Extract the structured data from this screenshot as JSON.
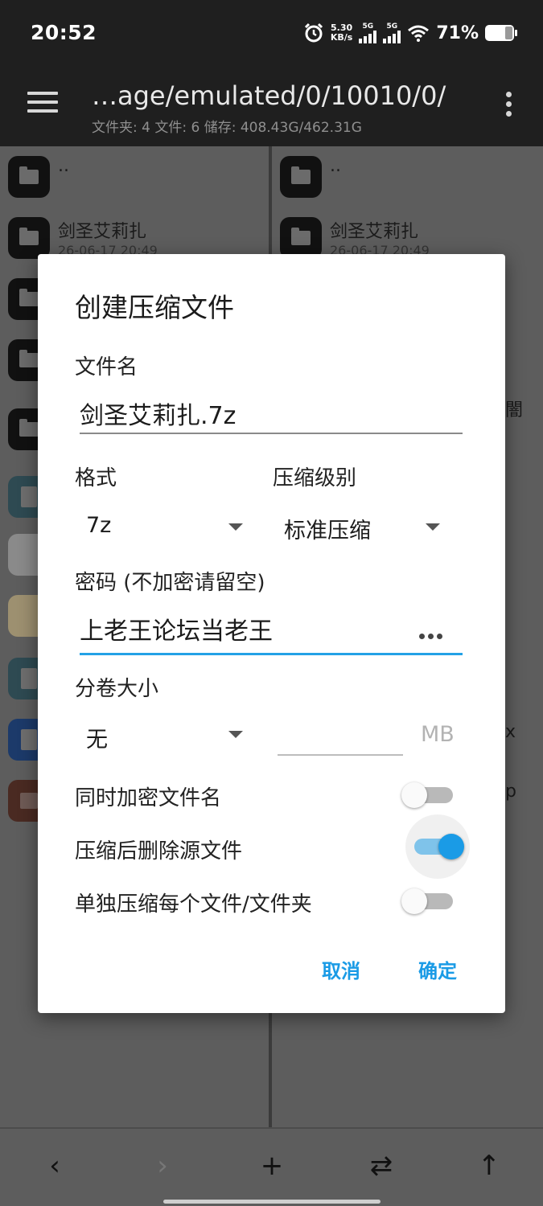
{
  "status_bar": {
    "time": "20:52",
    "net_speed_value": "5.30",
    "net_speed_unit": "KB/s",
    "sim1_label": "5G",
    "sim2_label": "5G",
    "battery_percent": "71%",
    "battery_level": 0.71
  },
  "toolbar": {
    "path": "…age/emulated/0/10010/0/",
    "summary": "文件夹: 4  文件: 6  储存: 408.43G/462.31G"
  },
  "left_pane": {
    "items": [
      {
        "name": ".."
      },
      {
        "name": "剑圣艾莉扎",
        "date": "26-06-17 20:49"
      }
    ]
  },
  "right_pane": {
    "items": [
      {
        "name": ".."
      },
      {
        "name": "剑圣艾莉扎",
        "date": "26-06-17 20:49"
      }
    ],
    "peek_texts": [
      "闇",
      "x",
      "p"
    ]
  },
  "dialog": {
    "title": "创建压缩文件",
    "filename_label": "文件名",
    "filename_value": "剑圣艾莉扎.7z",
    "format_label": "格式",
    "format_value": "7z",
    "level_label": "压缩级别",
    "level_value": "标准压缩",
    "password_label": "密码 (不加密请留空)",
    "password_value": "上老王论坛当老王",
    "volume_label": "分卷大小",
    "volume_value": "无",
    "volume_unit": "MB",
    "toggles": [
      {
        "label": "同时加密文件名",
        "on": false
      },
      {
        "label": "压缩后删除源文件",
        "on": true
      },
      {
        "label": "单独压缩每个文件/文件夹",
        "on": false
      }
    ],
    "cancel_label": "取消",
    "ok_label": "确定",
    "accent_color": "#1a9be6"
  }
}
